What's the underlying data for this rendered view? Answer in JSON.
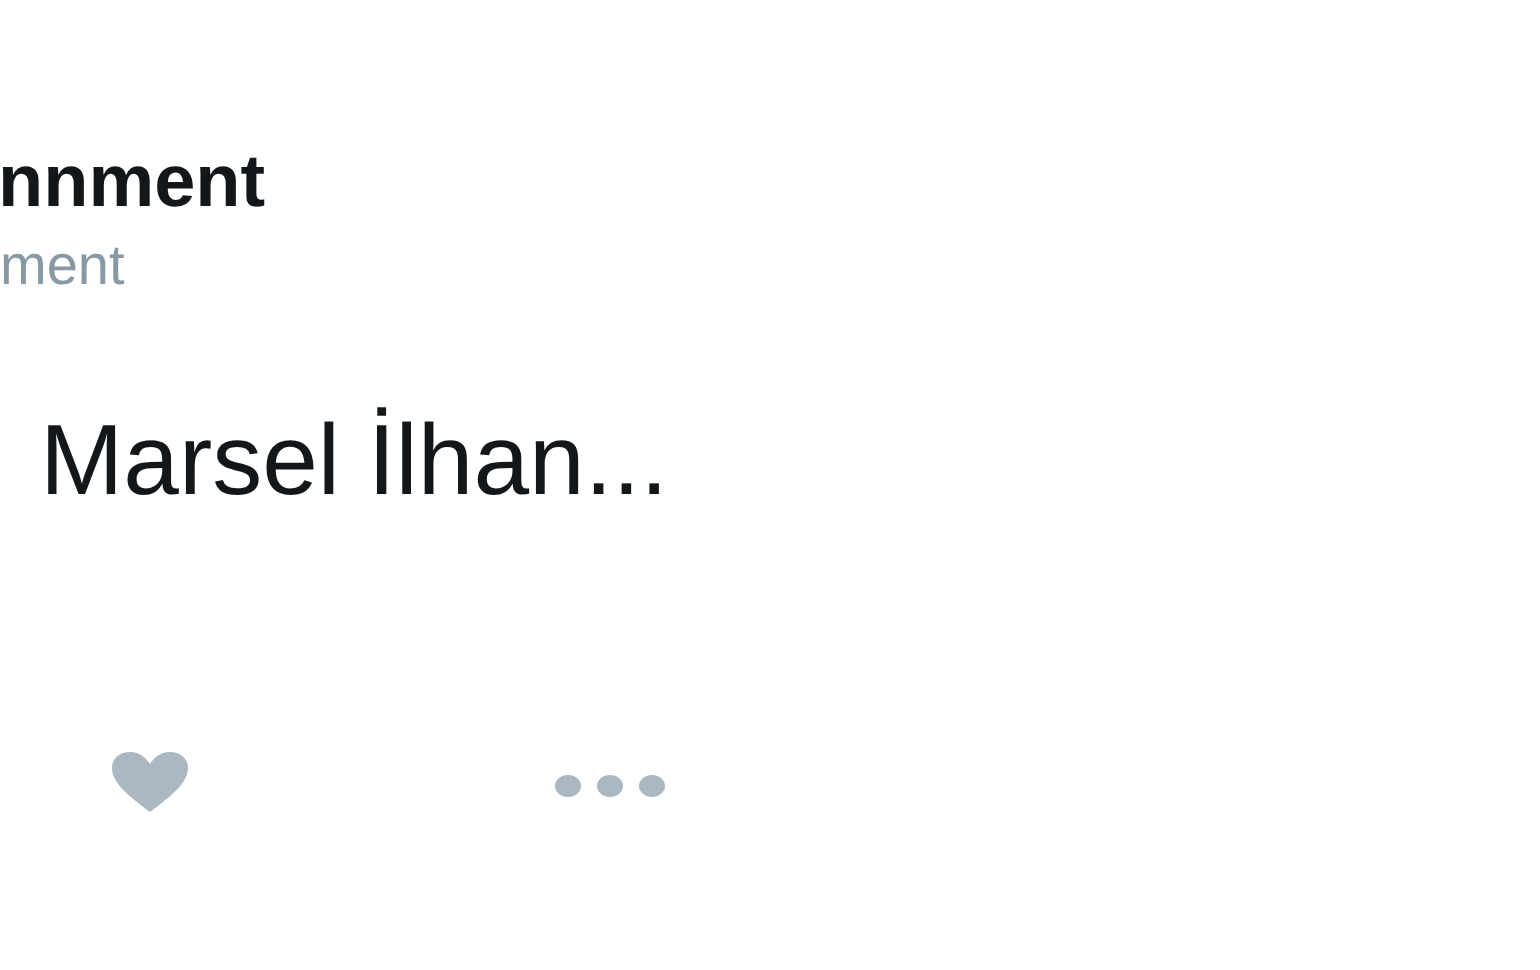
{
  "tweet": {
    "display_name": "nnment",
    "handle": "ment",
    "text": "Marsel İlhan..."
  }
}
